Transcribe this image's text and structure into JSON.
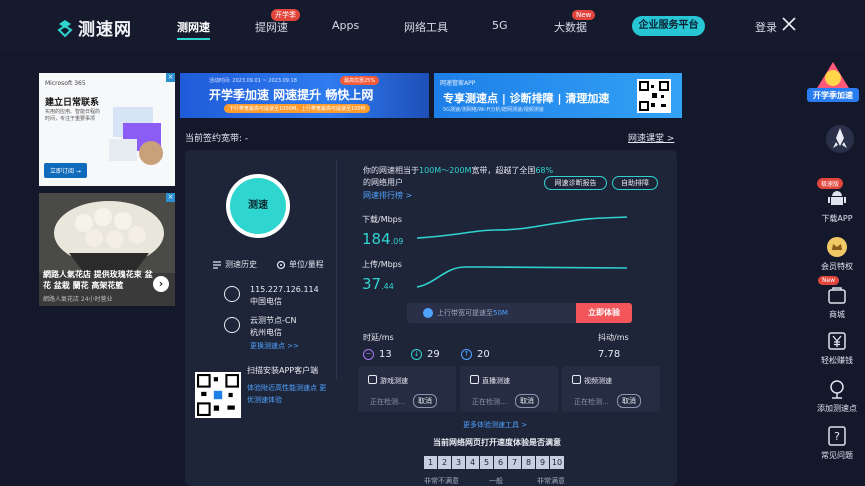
{
  "nav": {
    "logo_text": "测速网",
    "items": [
      "测网速",
      "提网速",
      "Apps",
      "网络工具",
      "5G",
      "大数据"
    ],
    "badges": {
      "boost": "开学季",
      "bigdata": "New"
    },
    "enterprise": "企业服务平台",
    "login": "登录"
  },
  "ads": {
    "ms": {
      "brand": "Microsoft 365",
      "headline": "建立日常联系",
      "desc": "实用的应用、智能日程的时间，专注于重要事项",
      "cta": "立即订阅 →"
    },
    "flower": {
      "caption": "網路人氣花店 提供玫瑰花束 盆花 盆栽 蘭花 高架花籃",
      "shop": "網路人氣花店 24小时营业"
    },
    "speed": {
      "date": "活动时间: 2023.09.01 ~ 2023.09.18",
      "promo": "最高优惠25%",
      "title": "开学季加速 网速提升 畅快上网",
      "tag": "下行带宽最高可提速至1000M，上行带宽最高可提速至100M"
    },
    "app": {
      "hdr": "网速管家APP",
      "title": "专享测速点 | 诊断排障 | 清理加速",
      "sub": "5G测速/测网络/Wi-Fi分析/蹭网测速/视频测速"
    }
  },
  "contract": "当前签约宽带: -",
  "course": "网速课堂 >",
  "left": {
    "start": "测速",
    "history": "测速历史",
    "units": "单位/量程",
    "ip": "115.227.126.114",
    "isp": "中国电信",
    "node": "云测节点-CN",
    "node_isp": "杭州电信",
    "change_node": "更换测速点 >>",
    "app_title": "扫描安装APP客户端",
    "app_desc": "体验附近高性能测速点 更优测速体验"
  },
  "result": {
    "prefix": "你的网速相当于",
    "range": "100M～200M",
    "mid": "宽带，超越了全国",
    "pct": "68%",
    "suffix": "的网络用户",
    "rank": "网速排行榜 >",
    "diag": "网速诊断报告",
    "fix": "自助排障"
  },
  "download": {
    "label": "下载/Mbps",
    "int": "184",
    "dec": ".09"
  },
  "upload": {
    "label": "上传/Mbps",
    "int": "37",
    "dec": ".44"
  },
  "boost": {
    "text_pre": "上行带宽可提速至",
    "text_hl": "50M",
    "btn": "立即体验"
  },
  "latency": {
    "title": "时延/ms",
    "v1": "13",
    "v2": "29",
    "v3": "20",
    "jitter_title": "抖动/ms",
    "jitter": "7.78"
  },
  "tests": [
    {
      "name": "游戏测速",
      "status": "正在检测…",
      "cancel": "取消"
    },
    {
      "name": "直播测速",
      "status": "正在检测…",
      "cancel": "取消"
    },
    {
      "name": "视频测速",
      "status": "正在检测…",
      "cancel": "取消"
    }
  ],
  "more_tools": "更多体验测速工具 >",
  "rating": {
    "title": "当前网络网页打开速度体验是否满意",
    "scores": [
      "1",
      "2",
      "3",
      "4",
      "5",
      "6",
      "7",
      "8",
      "9",
      "10"
    ],
    "low": "非常不满意",
    "mid": "一般",
    "high": "非常满意"
  },
  "sidebar": {
    "banner": "开学季加速",
    "download_app": "下载APP",
    "download_badge": "极速版",
    "vip": "会员特权",
    "mall": "商城",
    "mall_badge": "New",
    "earn": "轻松赚钱",
    "add_node": "添加测速点",
    "faq": "常见问题"
  },
  "colors": {
    "accent": "#2fd3d0",
    "link": "#4fa3ff",
    "cta": "#f2555a",
    "bg": "#13182b",
    "panel": "#1f2538"
  }
}
